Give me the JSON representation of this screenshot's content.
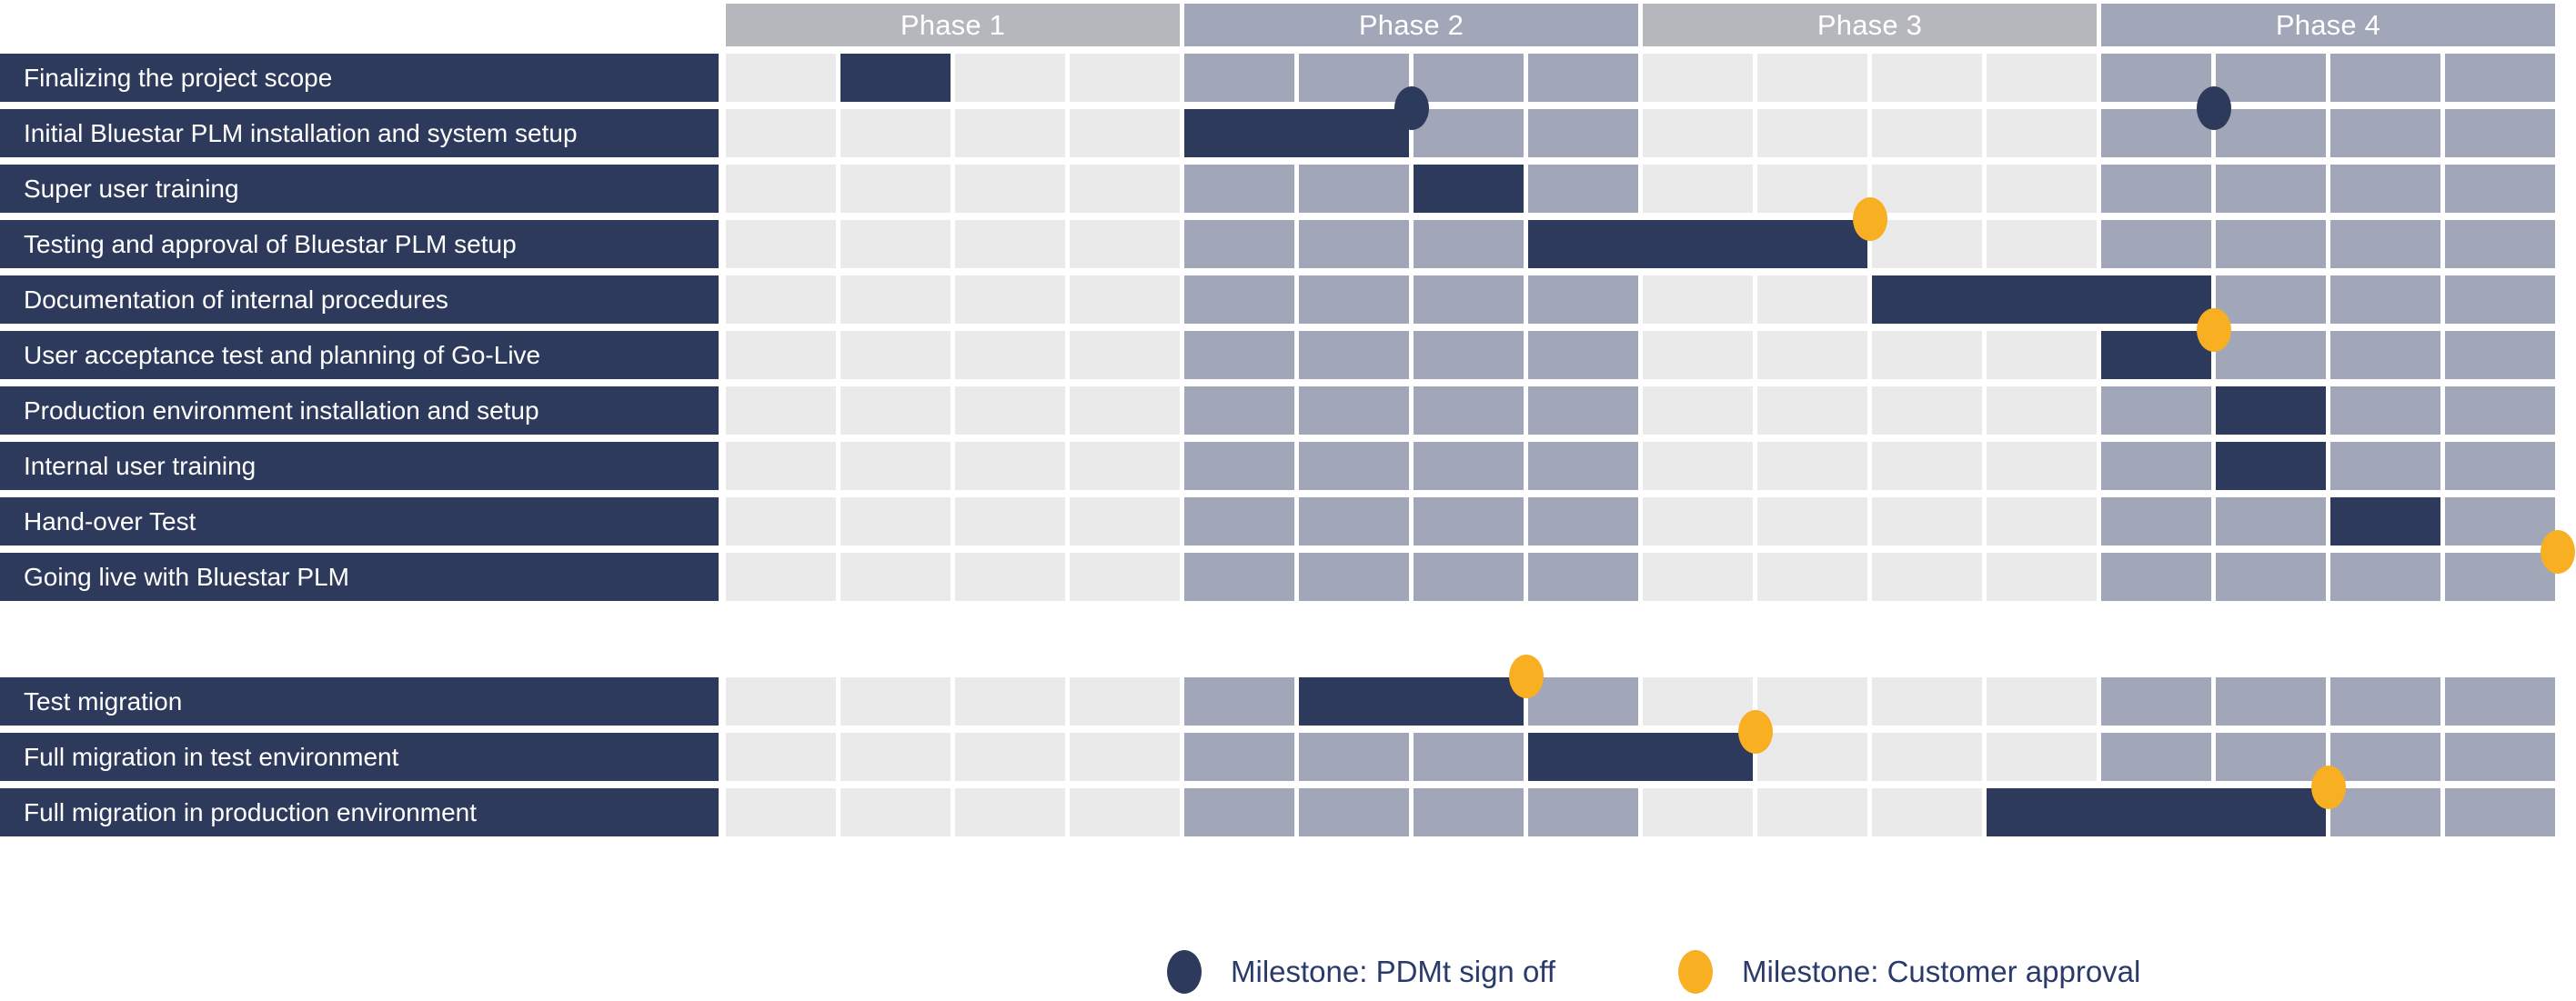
{
  "chart_data": {
    "type": "bar",
    "title": "",
    "subtitle": "",
    "xlabel": "",
    "ylabel": "",
    "grid": true,
    "legend_position": "bottom-center",
    "axis": {
      "columns_total": 16,
      "columns_per_phase": 4,
      "column_range": [
        0,
        16
      ]
    },
    "phases": [
      {
        "label": "Phase 1",
        "start_col": 0,
        "end_col": 4,
        "color": "#B5B7BC"
      },
      {
        "label": "Phase 2",
        "start_col": 4,
        "end_col": 8,
        "color": "#A1A6B8"
      },
      {
        "label": "Phase 3",
        "start_col": 8,
        "end_col": 12,
        "color": "#B5B7BC"
      },
      {
        "label": "Phase 4",
        "start_col": 12,
        "end_col": 16,
        "color": "#A1A6B8"
      }
    ],
    "categories": [
      "Finalizing the project scope",
      "Initial Bluestar PLM installation and system setup",
      "Super user training",
      "Testing and approval of Bluestar PLM setup",
      "Documentation of internal procedures",
      "User acceptance test and planning of Go-Live",
      "Production environment installation and setup",
      "Internal user training",
      "Hand-over Test",
      "Going live with Bluestar PLM",
      "Test migration",
      "Full migration in test environment",
      "Full migration in production environment"
    ],
    "series": [
      {
        "name": "Task duration",
        "color": "#2D3A5C",
        "values": [
          {
            "task": "Finalizing the project scope",
            "start_col": 1,
            "span": 1
          },
          {
            "task": "Initial Bluestar PLM installation and system setup",
            "start_col": 4,
            "span": 2
          },
          {
            "task": "Super user training",
            "start_col": 6,
            "span": 1
          },
          {
            "task": "Testing and approval of Bluestar PLM setup",
            "start_col": 7,
            "span": 3
          },
          {
            "task": "Documentation of internal procedures",
            "start_col": 10,
            "span": 3
          },
          {
            "task": "User acceptance test and planning of Go-Live",
            "start_col": 12,
            "span": 1
          },
          {
            "task": "Production environment installation and setup",
            "start_col": 13,
            "span": 1
          },
          {
            "task": "Internal user training",
            "start_col": 13,
            "span": 1
          },
          {
            "task": "Hand-over Test",
            "start_col": 14,
            "span": 1
          },
          {
            "task": "Going live with Bluestar PLM",
            "start_col": null,
            "span": 0
          },
          {
            "task": "Test migration",
            "start_col": 5,
            "span": 2
          },
          {
            "task": "Full migration in test environment",
            "start_col": 7,
            "span": 2
          },
          {
            "task": "Full migration in production environment",
            "start_col": 11,
            "span": 3
          }
        ]
      }
    ],
    "milestones": [
      {
        "task": "Initial Bluestar PLM installation and system setup",
        "at_col": 6,
        "type": "pdmt"
      },
      {
        "task": "Initial Bluestar PLM installation and system setup",
        "at_col": 13,
        "type": "pdmt"
      },
      {
        "task": "Testing and approval of Bluestar PLM setup",
        "at_col": 10,
        "type": "customer"
      },
      {
        "task": "User acceptance test and planning of Go-Live",
        "at_col": 13,
        "type": "customer"
      },
      {
        "task": "Going live with Bluestar PLM",
        "at_col": 16,
        "type": "customer"
      },
      {
        "task": "Test migration",
        "at_col": 7,
        "type": "customer"
      },
      {
        "task": "Full migration in test environment",
        "at_col": 9,
        "type": "customer"
      },
      {
        "task": "Full migration in production environment",
        "at_col": 14,
        "type": "customer"
      }
    ]
  },
  "header": {
    "phases": [
      {
        "label": "Phase 1"
      },
      {
        "label": "Phase 2"
      },
      {
        "label": "Phase 3"
      },
      {
        "label": "Phase 4"
      }
    ]
  },
  "rows": [
    {
      "label": "Finalizing the project scope"
    },
    {
      "label": "Initial Bluestar PLM installation and system setup"
    },
    {
      "label": "Super user training"
    },
    {
      "label": "Testing and approval of Bluestar PLM setup"
    },
    {
      "label": "Documentation of internal procedures"
    },
    {
      "label": "User acceptance test and planning of Go-Live"
    },
    {
      "label": "Production environment installation and setup"
    },
    {
      "label": "Internal user training"
    },
    {
      "label": "Hand-over Test"
    },
    {
      "label": "Going live with Bluestar PLM"
    },
    {
      "label": "Test migration"
    },
    {
      "label": "Full migration in test environment"
    },
    {
      "label": "Full migration in production environment"
    }
  ],
  "legend": {
    "items": [
      {
        "label": "Milestone: PDMt sign off",
        "marker": "milestone-navy-dot",
        "color": "#2D3A5C"
      },
      {
        "label": "Milestone: Customer approval",
        "marker": "milestone-orange-dot",
        "color": "#F9AF22"
      }
    ]
  },
  "colors": {
    "bar": "#2D3A5C",
    "label_bg": "#2D3A5C",
    "cell_light": "#EAEAEA",
    "cell_shade": "#A1A6B8",
    "phase_light": "#B5B7BC",
    "phase_shade": "#A1A6B8",
    "milestone_pdmt": "#2D3A5C",
    "milestone_customer": "#F9AF22",
    "legend_text": "#2A3A6B",
    "background": "#FFFFFF"
  }
}
